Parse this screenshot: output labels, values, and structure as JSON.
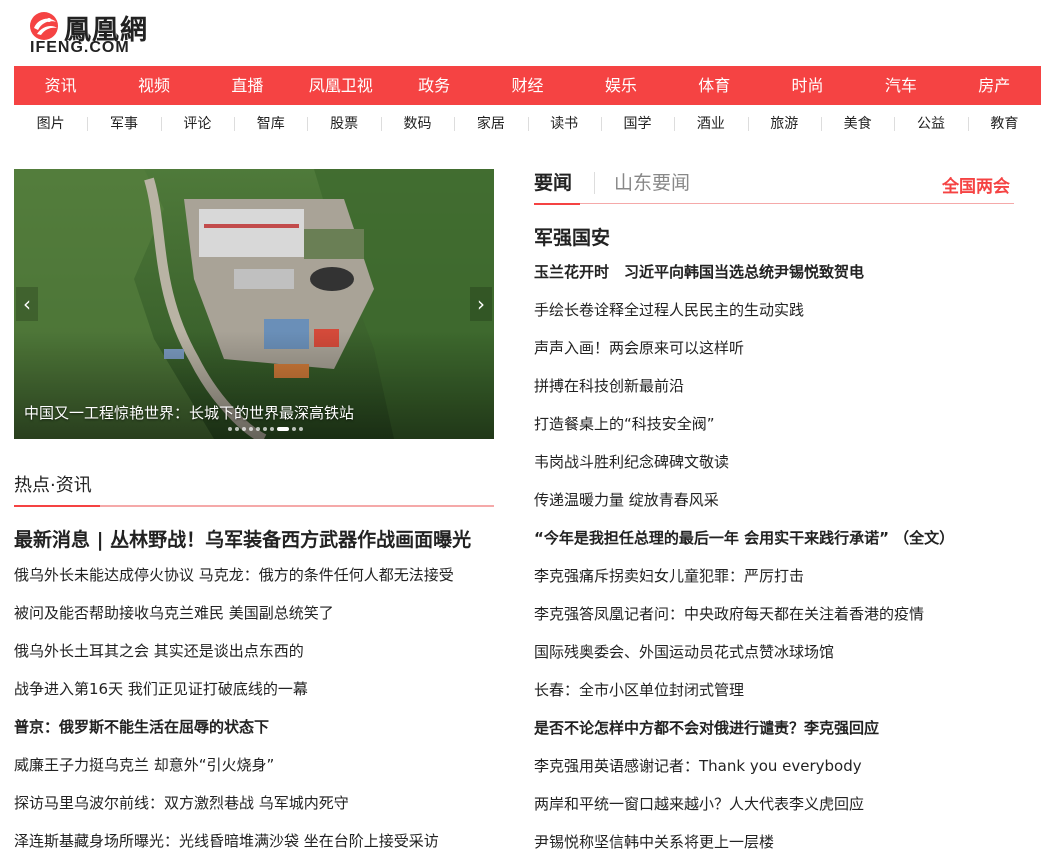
{
  "logo": {
    "cn": "鳳凰網",
    "en": "IFENG.COM"
  },
  "colors": {
    "brand_red": "#f54343",
    "accent_pink": "#f5a9a9"
  },
  "main_nav": [
    "资讯",
    "视频",
    "直播",
    "凤凰卫视",
    "政务",
    "财经",
    "娱乐",
    "体育",
    "时尚",
    "汽车",
    "房产"
  ],
  "sub_nav": [
    "图片",
    "军事",
    "评论",
    "智库",
    "股票",
    "数码",
    "家居",
    "读书",
    "国学",
    "酒业",
    "旅游",
    "美食",
    "公益",
    "教育"
  ],
  "slider": {
    "caption": "中国又一工程惊艳世界：长城下的世界最深高铁站",
    "prev_icon": "‹",
    "next_icon": "›",
    "dots_count": 10,
    "active_dot": 7
  },
  "hot": {
    "title": "热点·资讯",
    "headline": "最新消息 | 丛林野战！乌军装备西方武器作战画面曝光",
    "items": [
      {
        "text": "俄乌外长未能达成停火协议 马克龙：俄方的条件任何人都无法接受",
        "bold": false
      },
      {
        "text": "被问及能否帮助接收乌克兰难民 美国副总统笑了",
        "bold": false
      },
      {
        "text": "俄乌外长土耳其之会 其实还是谈出点东西的",
        "bold": false
      },
      {
        "text": "战争进入第16天 我们正见证打破底线的一幕",
        "bold": false
      },
      {
        "text": "普京：俄罗斯不能生活在屈辱的状态下",
        "bold": true
      },
      {
        "text": "威廉王子力挺乌克兰 却意外“引火烧身”",
        "bold": false
      },
      {
        "text": "探访马里乌波尔前线：双方激烈巷战 乌军城内死守",
        "bold": false
      },
      {
        "text": "泽连斯基藏身场所曝光：光线昏暗堆满沙袋 坐在台阶上接受采访",
        "bold": false
      }
    ]
  },
  "right": {
    "tab1": "要闻",
    "tab2": "山东要闻",
    "tab_right": "全国两会",
    "section": "军强国安",
    "items": [
      {
        "text": "玉兰花开时　习近平向韩国当选总统尹锡悦致贺电",
        "bold": true
      },
      {
        "text": "手绘长卷诠释全过程人民民主的生动实践",
        "bold": false
      },
      {
        "text": "声声入画！两会原来可以这样听",
        "bold": false
      },
      {
        "text": "拼搏在科技创新最前沿",
        "bold": false
      },
      {
        "text": "打造餐桌上的“科技安全阀”",
        "bold": false
      },
      {
        "text": "韦岗战斗胜利纪念碑碑文敬读",
        "bold": false
      },
      {
        "text": "传递温暖力量 绽放青春风采",
        "bold": false
      },
      {
        "text": "“今年是我担任总理的最后一年 会用实干来践行承诺” （全文）",
        "bold": true
      },
      {
        "text": "李克强痛斥拐卖妇女儿童犯罪：严厉打击",
        "bold": false
      },
      {
        "text": "李克强答凤凰记者问：中央政府每天都在关注着香港的疫情",
        "bold": false
      },
      {
        "text": "国际残奥委会、外国运动员花式点赞冰球场馆",
        "bold": false
      },
      {
        "text": "长春：全市小区单位封闭式管理",
        "bold": false
      },
      {
        "text": "是否不论怎样中方都不会对俄进行谴责？李克强回应",
        "bold": true
      },
      {
        "text": "李克强用英语感谢记者：Thank you everybody",
        "bold": false
      },
      {
        "text": "两岸和平统一窗口越来越小？人大代表李义虎回应",
        "bold": false
      },
      {
        "text": "尹锡悦称坚信韩中关系将更上一层楼",
        "bold": false
      }
    ]
  }
}
